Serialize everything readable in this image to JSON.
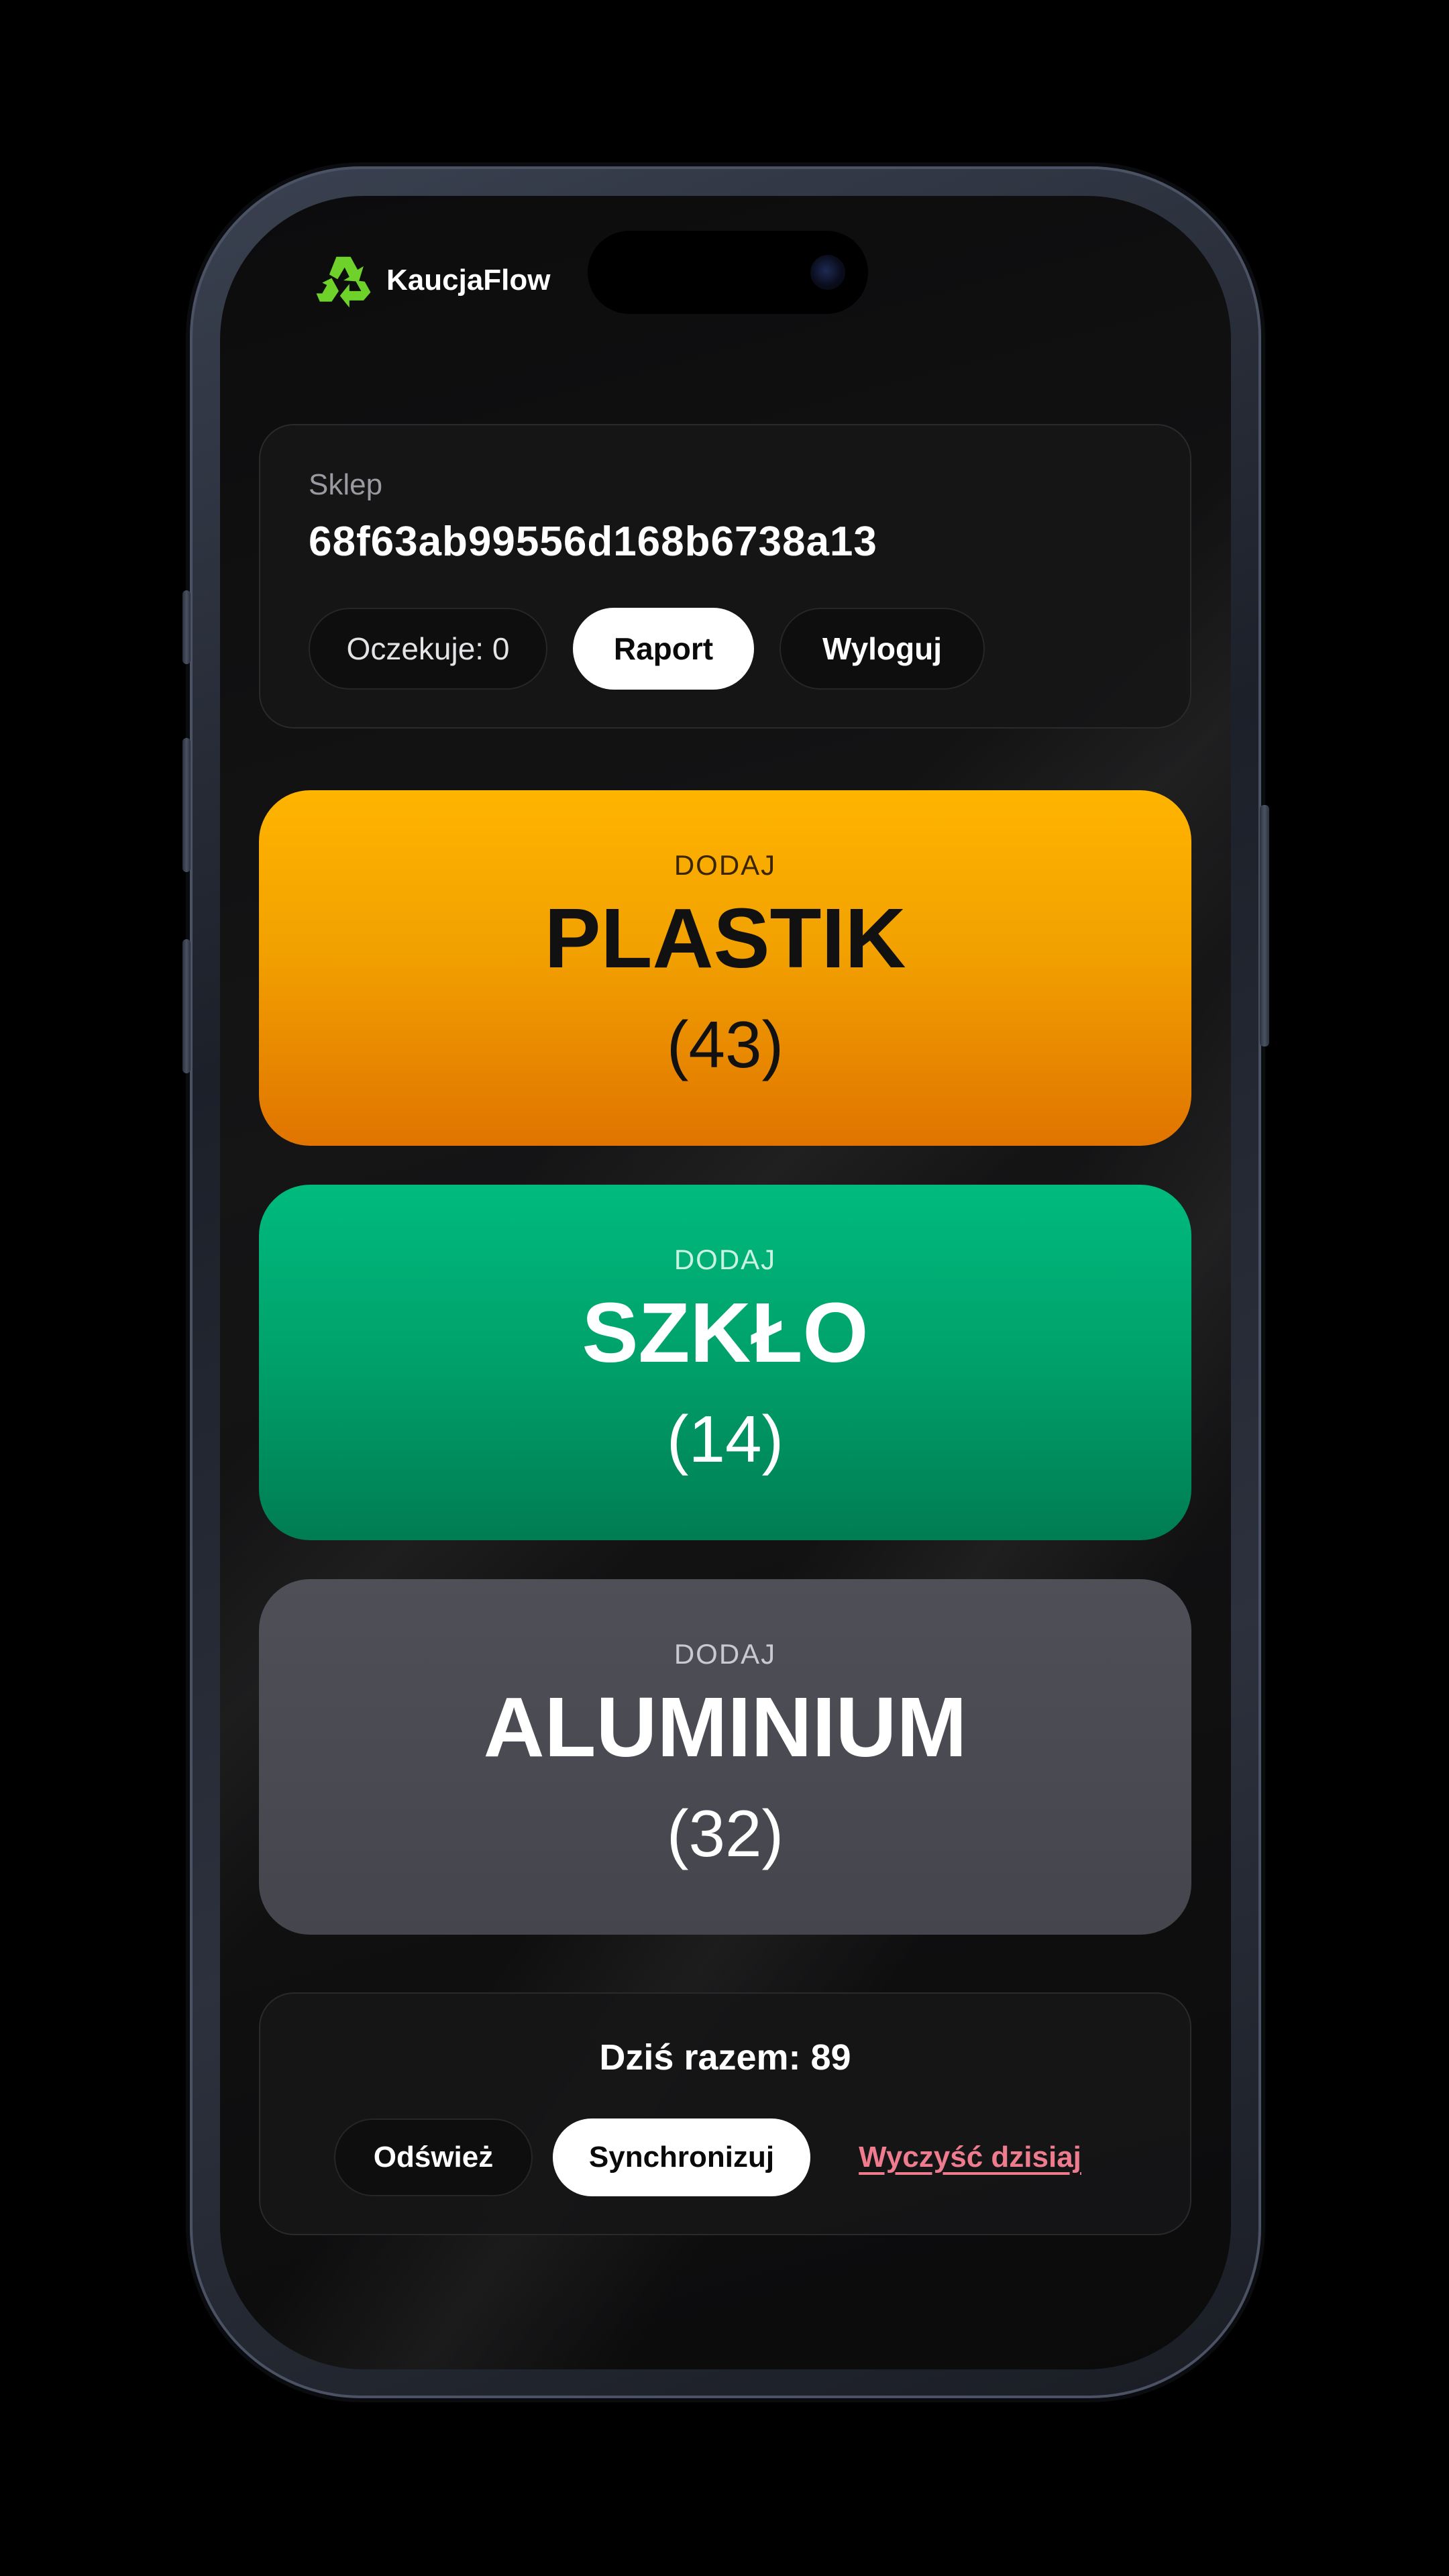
{
  "app": {
    "name": "KaucjaFlow",
    "logo_icon": "recycle-icon",
    "brand_color": "#6ed22a"
  },
  "store": {
    "label": "Sklep",
    "id": "68f63ab99556d168b6738a13",
    "pending_label": "Oczekuje: 0",
    "report_label": "Raport",
    "logout_label": "Wyloguj"
  },
  "materials": [
    {
      "kicker": "DODAJ",
      "name": "PLASTIK",
      "count": "(43)",
      "color": "#f2a100"
    },
    {
      "kicker": "DODAJ",
      "name": "SZKŁO",
      "count": "(14)",
      "color": "#00a06a"
    },
    {
      "kicker": "DODAJ",
      "name": "ALUMINIUM",
      "count": "(32)",
      "color": "#48484f"
    }
  ],
  "summary": {
    "total": "Dziś razem: 89",
    "refresh_label": "Odśwież",
    "sync_label": "Synchronizuj",
    "clear_label": "Wyczyść dzisiaj",
    "clear_color": "#ef7c8e"
  }
}
